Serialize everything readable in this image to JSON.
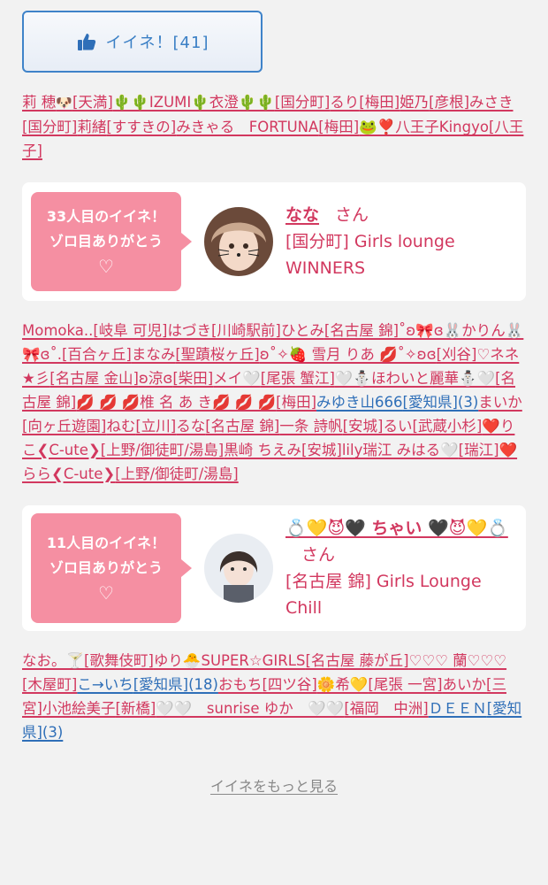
{
  "like_button": {
    "label": "イイネ！[41]",
    "icon": "thumbs-up-icon",
    "color": "#3a7fc5"
  },
  "group1": [
    {
      "name": "莉 穂",
      "emoji": "🐶",
      "area": "[天満]"
    },
    {
      "name": "🌵🌵IZUMI🌵衣澄🌵🌵",
      "area": "[国分町]"
    },
    {
      "name": "るり",
      "area": "[梅田]"
    },
    {
      "name": "姫乃",
      "area": "[彦根]"
    },
    {
      "name": "みさき",
      "area": "[国分町]"
    },
    {
      "name": "莉緒",
      "area": "[すすきの]"
    },
    {
      "name": "みきゃる　FORTUNA",
      "area": "[梅田]"
    },
    {
      "name": "🐸❣️八王子Kingyo",
      "area": "[八王子]"
    }
  ],
  "card1": {
    "bubble_line1": "33人目のイイネ！",
    "bubble_line2": "ゾロ目ありがとう",
    "bubble_heart": "♡",
    "name": "なな",
    "suffix": "さん",
    "shop": "[国分町] Girls lounge WINNERS"
  },
  "group2": [
    {
      "name": "Momoka..",
      "area": "[岐阜 可児]"
    },
    {
      "name": "はづき",
      "area": "[川崎駅前]"
    },
    {
      "name": "ひとみ",
      "area": "[名古屋 錦]"
    },
    {
      "name": "˚ʚ🎀ɞ🐰かりん🐰🎀ɞ˚.",
      "area": "[百合ヶ丘]"
    },
    {
      "name": "まなみ",
      "area": "[聖蹟桜ヶ丘]"
    },
    {
      "name": "ʚ˚✧🍓 雪月 りあ 💋˚✧ʚɞ",
      "area": "[刈谷]"
    },
    {
      "name": "♡ネネ★彡",
      "area": "[名古屋 金山]"
    },
    {
      "name": "ʚ涼ɞ",
      "area": "[柴田]"
    },
    {
      "name": "メイ🤍",
      "area": "[尾張 蟹江]"
    },
    {
      "name": "🤍⛄ほわいと麗華⛄🤍",
      "area": "[名古屋 錦]"
    },
    {
      "name": "💋 💋 💋椎 名 あ き💋 💋 💋",
      "area": "[梅田]"
    },
    {
      "name": "みゆき山666",
      "area": "[愛知県](3)",
      "blue": true
    },
    {
      "name": "まいか",
      "area": "[向ヶ丘遊園]"
    },
    {
      "name": "ねむ",
      "area": "[立川]"
    },
    {
      "name": "るな",
      "area": "[名古屋 錦]"
    },
    {
      "name": "一条 詩帆",
      "area": "[安城]"
    },
    {
      "name": "るい",
      "area": "[武蔵小杉]"
    },
    {
      "name": "❤️りこ❮C-ute❯",
      "area": "[上野/御徒町/湯島]"
    },
    {
      "name": "黒崎 ちえみ",
      "area": "[安城]"
    },
    {
      "name": "lily瑞江 みはる🤍",
      "area": "[瑞江]"
    },
    {
      "name": "❤️らら❮C-ute❯",
      "area": "[上野/御徒町/湯島]"
    }
  ],
  "card2": {
    "bubble_line1": "11人目のイイネ！",
    "bubble_line2": "ゾロ目ありがとう",
    "bubble_heart": "♡",
    "name": "💍💛😈🖤 ちゃい 🖤😈💛💍",
    "suffix": "さん",
    "shop": "[名古屋 錦] Girls Lounge Chill"
  },
  "group3": [
    {
      "name": "なお。🍸",
      "area": "[歌舞伎町]"
    },
    {
      "name": "ゆり🐣SUPER☆GIRLS",
      "area": "[名古屋 藤が丘]"
    },
    {
      "name": "♡♡♡ 蘭♡♡♡",
      "area": "[木屋町]"
    },
    {
      "name": "こ→いち",
      "area": "[愛知県](18)",
      "blue": true
    },
    {
      "name": "おもち",
      "area": "[四ツ谷]"
    },
    {
      "name": "🌼希💛",
      "area": "[尾張 一宮]"
    },
    {
      "name": "あいか",
      "area": "[三宮]"
    },
    {
      "name": "小池絵美子",
      "area": "[新橋]"
    },
    {
      "name": "🤍🤍　sunrise ゆか　🤍🤍",
      "area": "[福岡　中洲]"
    },
    {
      "name": "ＤＥＥＮ",
      "area": "[愛知県](3)",
      "blue": true
    }
  ],
  "more_link": "イイネをもっと見る",
  "colors": {
    "accent": "#d2385f",
    "bubble": "#f58fa2",
    "link_blue": "#2f6fb8"
  }
}
